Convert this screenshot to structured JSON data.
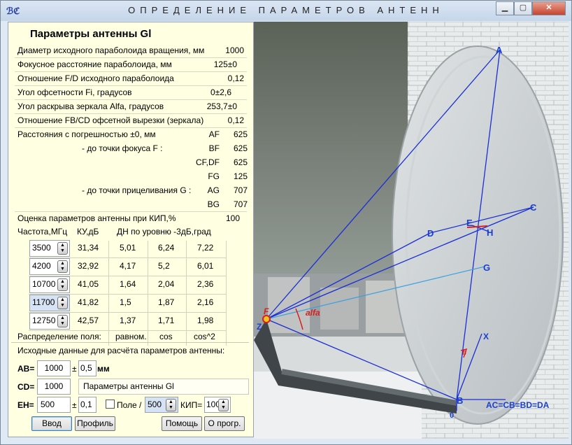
{
  "window": {
    "title": "ОПРЕДЕЛЕНИЕ ПАРАМЕТРОВ АНТЕНН",
    "icon_text": "ℬℭ"
  },
  "panel": {
    "heading": "Параметры антенны Gl",
    "params": [
      {
        "label": "Диаметр исходного параболоида вращения, мм",
        "value": "1000"
      },
      {
        "label": "Фокусное расстояние параболоида, мм",
        "value": "125±0"
      },
      {
        "label": "Отношение F/D исходного параболоида",
        "value": "0,12"
      },
      {
        "label": "Угол офсетности Fi, градусов",
        "value": "0±2,6"
      },
      {
        "label": "Угол раскрыва зеркала Alfa, градусов",
        "value": "253,7±0"
      },
      {
        "label": "Отношение FB/CD офсетной вырезки (зеркала)",
        "value": "0,12"
      }
    ],
    "dist_header": "Расстояния с погрешностью ±0, мм",
    "focus_label": "- до точки фокуса F :",
    "aim_label": "- до точки прицеливания G :",
    "distances": [
      {
        "name": "AF",
        "value": "625"
      },
      {
        "name": "BF",
        "value": "625"
      },
      {
        "name": "CF,DF",
        "value": "625"
      },
      {
        "name": "FG",
        "value": "125"
      },
      {
        "name": "AG",
        "value": "707"
      },
      {
        "name": "BG",
        "value": "707"
      }
    ],
    "kip_label": "Оценка параметров антенны при КИП,%",
    "kip_value": "100",
    "table_headers": {
      "freq": "Частота,МГц",
      "gain": "КУ,дБ",
      "dn": "ДН по уровню -3дБ,град"
    },
    "rows": [
      {
        "freq": "3500",
        "gain": "31,34",
        "a": "5,01",
        "b": "6,24",
        "c": "7,22"
      },
      {
        "freq": "4200",
        "gain": "32,92",
        "a": "4,17",
        "b": "5,2",
        "c": "6,01"
      },
      {
        "freq": "10700",
        "gain": "41,05",
        "a": "1,64",
        "b": "2,04",
        "c": "2,36"
      },
      {
        "freq": "11700",
        "gain": "41,82",
        "a": "1,5",
        "b": "1,87",
        "c": "2,16"
      },
      {
        "freq": "12750",
        "gain": "42,57",
        "a": "1,37",
        "b": "1,71",
        "c": "1,98"
      }
    ],
    "distribution": {
      "label": "Распределение поля:",
      "a": "равном.",
      "b": "cos",
      "c": "cos^2"
    },
    "inputs_header": "Исходные данные для расчёта параметров антенны:",
    "ab": {
      "label": "AB=",
      "value": "1000",
      "pm": "±",
      "tol": "0,5",
      "unit": "мм"
    },
    "cd": {
      "label": "CD=",
      "value": "1000",
      "name_value": "Параметры антенны Gl"
    },
    "eh": {
      "label": "EH=",
      "value": "500",
      "pm": "±",
      "tol": "0,1",
      "pole_label": "Поле /",
      "pole_value": "500",
      "kip_label": "КИП=",
      "kip_value": "100"
    },
    "buttons": {
      "enter": "Ввод",
      "profile": "Профиль",
      "help": "Помощь",
      "about": "О прогр."
    }
  },
  "photo": {
    "points": {
      "A": "A",
      "B": "B",
      "C": "C",
      "D": "D",
      "E": "E",
      "F": "F",
      "G": "G",
      "H": "H",
      "O": "0",
      "X": "X",
      "Z": "Z"
    },
    "alfa": "alfa",
    "fi": "fi",
    "equation": "AC=CB=BD=DA"
  },
  "colors": {
    "panel_bg": "#ffffe1",
    "line_blue": "#1a2fd6",
    "label_blue": "#1a3fd0",
    "focus_red": "#d81e1e"
  }
}
